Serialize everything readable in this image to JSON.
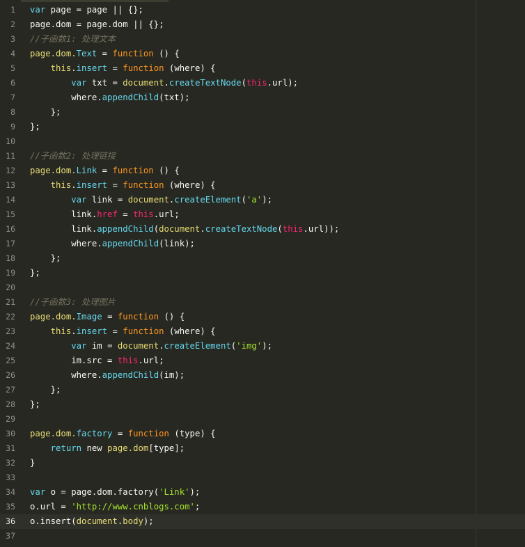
{
  "editor": {
    "current_line": 36,
    "lines": [
      {
        "n": "1",
        "tokens": [
          [
            "k",
            "var"
          ],
          [
            "o",
            " page = page || {};"
          ]
        ]
      },
      {
        "n": "2",
        "tokens": [
          [
            "o",
            "page.dom = page.dom || {};"
          ]
        ]
      },
      {
        "n": "3",
        "tokens": [
          [
            "c",
            "//子函数1: 处理文本"
          ]
        ]
      },
      {
        "n": "4",
        "tokens": [
          [
            "y",
            "page.dom."
          ],
          [
            "m",
            "Text"
          ],
          [
            "o",
            " = "
          ],
          [
            "fn",
            "function"
          ],
          [
            "o",
            " () {"
          ]
        ]
      },
      {
        "n": "5",
        "tokens": [
          [
            "o",
            "    "
          ],
          [
            "y",
            "this"
          ],
          [
            "o",
            "."
          ],
          [
            "m",
            "insert"
          ],
          [
            "o",
            " = "
          ],
          [
            "fn",
            "function"
          ],
          [
            "o",
            " (where) {"
          ]
        ]
      },
      {
        "n": "6",
        "tokens": [
          [
            "o",
            "        "
          ],
          [
            "k",
            "var"
          ],
          [
            "o",
            " txt = "
          ],
          [
            "d",
            "document"
          ],
          [
            "o",
            "."
          ],
          [
            "m",
            "createTextNode"
          ],
          [
            "o",
            "("
          ],
          [
            "t",
            "this"
          ],
          [
            "o",
            ".url);"
          ]
        ]
      },
      {
        "n": "7",
        "tokens": [
          [
            "o",
            "        where."
          ],
          [
            "m",
            "appendChild"
          ],
          [
            "o",
            "(txt);"
          ]
        ]
      },
      {
        "n": "8",
        "tokens": [
          [
            "o",
            "    };"
          ]
        ]
      },
      {
        "n": "9",
        "tokens": [
          [
            "o",
            "};"
          ]
        ]
      },
      {
        "n": "10",
        "tokens": []
      },
      {
        "n": "11",
        "tokens": [
          [
            "c",
            "//子函数2: 处理链接"
          ]
        ]
      },
      {
        "n": "12",
        "tokens": [
          [
            "y",
            "page.dom."
          ],
          [
            "m",
            "Link"
          ],
          [
            "o",
            " = "
          ],
          [
            "fn",
            "function"
          ],
          [
            "o",
            " () {"
          ]
        ]
      },
      {
        "n": "13",
        "tokens": [
          [
            "o",
            "    "
          ],
          [
            "y",
            "this"
          ],
          [
            "o",
            "."
          ],
          [
            "m",
            "insert"
          ],
          [
            "o",
            " = "
          ],
          [
            "fn",
            "function"
          ],
          [
            "o",
            " (where) {"
          ]
        ]
      },
      {
        "n": "14",
        "tokens": [
          [
            "o",
            "        "
          ],
          [
            "k",
            "var"
          ],
          [
            "o",
            " link = "
          ],
          [
            "d",
            "document"
          ],
          [
            "o",
            "."
          ],
          [
            "m",
            "createElement"
          ],
          [
            "o",
            "("
          ],
          [
            "s",
            "'a'"
          ],
          [
            "o",
            ");"
          ]
        ]
      },
      {
        "n": "15",
        "tokens": [
          [
            "o",
            "        link."
          ],
          [
            "t",
            "href"
          ],
          [
            "o",
            " = "
          ],
          [
            "t",
            "this"
          ],
          [
            "o",
            ".url;"
          ]
        ]
      },
      {
        "n": "16",
        "tokens": [
          [
            "o",
            "        link."
          ],
          [
            "m",
            "appendChild"
          ],
          [
            "o",
            "("
          ],
          [
            "d",
            "document"
          ],
          [
            "o",
            "."
          ],
          [
            "m",
            "createTextNode"
          ],
          [
            "o",
            "("
          ],
          [
            "t",
            "this"
          ],
          [
            "o",
            ".url));"
          ]
        ]
      },
      {
        "n": "17",
        "tokens": [
          [
            "o",
            "        where."
          ],
          [
            "m",
            "appendChild"
          ],
          [
            "o",
            "(link);"
          ]
        ]
      },
      {
        "n": "18",
        "tokens": [
          [
            "o",
            "    };"
          ]
        ]
      },
      {
        "n": "19",
        "tokens": [
          [
            "o",
            "};"
          ]
        ]
      },
      {
        "n": "20",
        "tokens": []
      },
      {
        "n": "21",
        "tokens": [
          [
            "c",
            "//子函数3: 处理图片"
          ]
        ]
      },
      {
        "n": "22",
        "tokens": [
          [
            "y",
            "page.dom."
          ],
          [
            "m",
            "Image"
          ],
          [
            "o",
            " = "
          ],
          [
            "fn",
            "function"
          ],
          [
            "o",
            " () {"
          ]
        ]
      },
      {
        "n": "23",
        "tokens": [
          [
            "o",
            "    "
          ],
          [
            "y",
            "this"
          ],
          [
            "o",
            "."
          ],
          [
            "m",
            "insert"
          ],
          [
            "o",
            " = "
          ],
          [
            "fn",
            "function"
          ],
          [
            "o",
            " (where) {"
          ]
        ]
      },
      {
        "n": "24",
        "tokens": [
          [
            "o",
            "        "
          ],
          [
            "k",
            "var"
          ],
          [
            "o",
            " im = "
          ],
          [
            "d",
            "document"
          ],
          [
            "o",
            "."
          ],
          [
            "m",
            "createElement"
          ],
          [
            "o",
            "("
          ],
          [
            "s",
            "'img'"
          ],
          [
            "o",
            ");"
          ]
        ]
      },
      {
        "n": "25",
        "tokens": [
          [
            "o",
            "        im.src = "
          ],
          [
            "t",
            "this"
          ],
          [
            "o",
            ".url;"
          ]
        ]
      },
      {
        "n": "26",
        "tokens": [
          [
            "o",
            "        where."
          ],
          [
            "m",
            "appendChild"
          ],
          [
            "o",
            "(im);"
          ]
        ]
      },
      {
        "n": "27",
        "tokens": [
          [
            "o",
            "    };"
          ]
        ]
      },
      {
        "n": "28",
        "tokens": [
          [
            "o",
            "};"
          ]
        ]
      },
      {
        "n": "29",
        "tokens": []
      },
      {
        "n": "30",
        "tokens": [
          [
            "y",
            "page.dom."
          ],
          [
            "m",
            "factory"
          ],
          [
            "o",
            " = "
          ],
          [
            "fn",
            "function"
          ],
          [
            "o",
            " (type) {"
          ]
        ]
      },
      {
        "n": "31",
        "tokens": [
          [
            "o",
            "    "
          ],
          [
            "k",
            "return"
          ],
          [
            "o",
            " new "
          ],
          [
            "y",
            "page.dom"
          ],
          [
            "o",
            "[type];"
          ]
        ]
      },
      {
        "n": "32",
        "tokens": [
          [
            "o",
            "}"
          ]
        ]
      },
      {
        "n": "33",
        "tokens": []
      },
      {
        "n": "34",
        "tokens": [
          [
            "k",
            "var"
          ],
          [
            "o",
            " o = page.dom.factory("
          ],
          [
            "s",
            "'Link'"
          ],
          [
            "o",
            ");"
          ]
        ]
      },
      {
        "n": "35",
        "tokens": [
          [
            "o",
            "o.url = "
          ],
          [
            "s",
            "'http://www.cnblogs.com'"
          ],
          [
            "o",
            ";"
          ]
        ]
      },
      {
        "n": "36",
        "tokens": [
          [
            "o",
            "o.insert("
          ],
          [
            "d",
            "document"
          ],
          [
            "o",
            "."
          ],
          [
            "y",
            "body"
          ],
          [
            "o",
            ");"
          ]
        ]
      },
      {
        "n": "37",
        "tokens": []
      }
    ]
  }
}
